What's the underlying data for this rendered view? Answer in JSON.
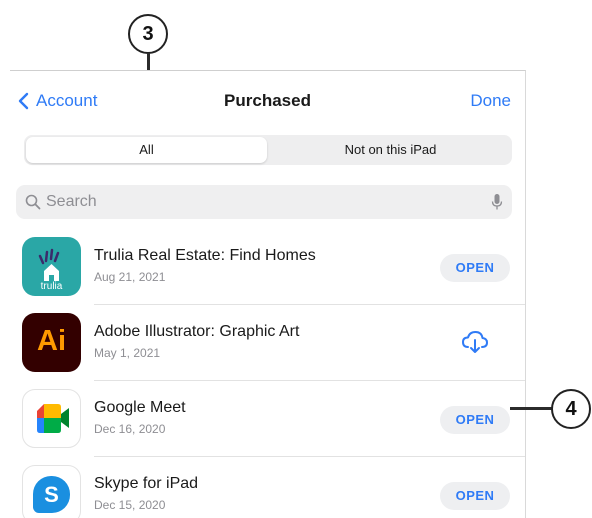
{
  "nav": {
    "back_label": "Account",
    "title": "Purchased",
    "done_label": "Done"
  },
  "segments": {
    "all_label": "All",
    "not_label": "Not on this iPad"
  },
  "search": {
    "placeholder": "Search"
  },
  "apps": [
    {
      "name": "Trulia Real Estate: Find Homes",
      "date": "Aug 21, 2021",
      "action": "OPEN",
      "icon_text": "trulia",
      "icon": "trulia-app-icon"
    },
    {
      "name": "Adobe Illustrator: Graphic Art",
      "date": "May 1, 2021",
      "action": "download",
      "icon_text": "Ai",
      "icon": "illustrator-app-icon"
    },
    {
      "name": "Google Meet",
      "date": "Dec 16, 2020",
      "action": "OPEN",
      "icon": "google-meet-app-icon"
    },
    {
      "name": "Skype for iPad",
      "date": "Dec 15, 2020",
      "action": "OPEN",
      "icon_text": "S",
      "icon": "skype-app-icon"
    }
  ],
  "callouts": {
    "c3": "3",
    "c4": "4"
  },
  "colors": {
    "accent": "#2f7bf6",
    "segment_bg": "#eeeeef",
    "button_bg": "#eeeff1"
  }
}
